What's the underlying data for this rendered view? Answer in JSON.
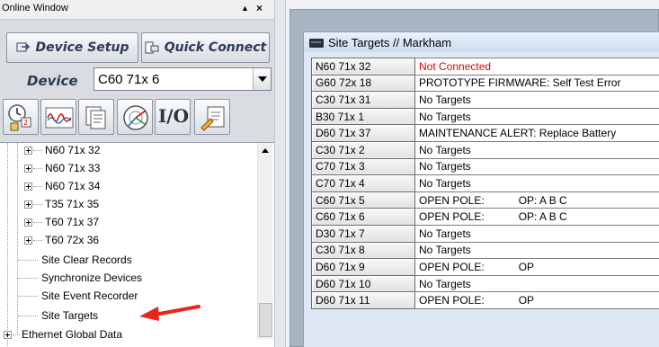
{
  "left_pane": {
    "title": "Online Window",
    "pin_glyph": "▲",
    "close_glyph": "×",
    "device_setup_label": "Device Setup",
    "quick_connect_label": "Quick Connect",
    "device_label": "Device",
    "device_value": "C60 71x 6",
    "io_label": "I/O",
    "tree": {
      "devices": [
        "N60 71x 32",
        "N60 71x 33",
        "N60 71x 34",
        "T35 71x 35",
        "T60 71x 37",
        "T60 72x 36"
      ],
      "actions": [
        "Site Clear Records",
        "Synchronize Devices",
        "Site Event Recorder",
        "Site Targets"
      ],
      "root_next": "Ethernet Global Data"
    }
  },
  "site_window": {
    "title": "Site Targets // Markham",
    "rows": [
      {
        "device": "N60 71x 32",
        "status": "Not Connected",
        "phase": "",
        "alert": true
      },
      {
        "device": "G60 72x 18",
        "status": "PROTOTYPE FIRMWARE: Self Test Error",
        "phase": "",
        "alert": false
      },
      {
        "device": "C30 71x 31",
        "status": "No Targets",
        "phase": "",
        "alert": false
      },
      {
        "device": "B30 71x 1",
        "status": "No Targets",
        "phase": "",
        "alert": false
      },
      {
        "device": "D60 71x 37",
        "status": "MAINTENANCE ALERT:  Replace Battery",
        "phase": "",
        "alert": false
      },
      {
        "device": "C30 71x 2",
        "status": "No Targets",
        "phase": "",
        "alert": false
      },
      {
        "device": "C70 71x 3",
        "status": "No Targets",
        "phase": "",
        "alert": false
      },
      {
        "device": "C70 71x 4",
        "status": "No Targets",
        "phase": "",
        "alert": false
      },
      {
        "device": "C60 71x 5",
        "status": "OPEN POLE:",
        "phase": "OP: A B C",
        "alert": false
      },
      {
        "device": "C60 71x 6",
        "status": "OPEN POLE:",
        "phase": "OP: A B C",
        "alert": false
      },
      {
        "device": "D30 71x 7",
        "status": "No Targets",
        "phase": "",
        "alert": false
      },
      {
        "device": "C30 71x 8",
        "status": "No Targets",
        "phase": "",
        "alert": false
      },
      {
        "device": "D60 71x 9",
        "status": "OPEN POLE:",
        "phase": "OP",
        "alert": false
      },
      {
        "device": "D60 71x 10",
        "status": "No Targets",
        "phase": "",
        "alert": false
      },
      {
        "device": "D60 71x 11",
        "status": "OPEN POLE:",
        "phase": "OP",
        "alert": false
      }
    ]
  },
  "colors": {
    "alert_text": "#e00000",
    "annotation_arrow": "#e8261c",
    "toolbar_text": "#2a3b55"
  },
  "icons": [
    "setup-icon",
    "quick-connect-icon",
    "clock-icon",
    "waveform-icon",
    "documents-icon",
    "phasor-icon",
    "settings-icon",
    "monitor-icon"
  ]
}
